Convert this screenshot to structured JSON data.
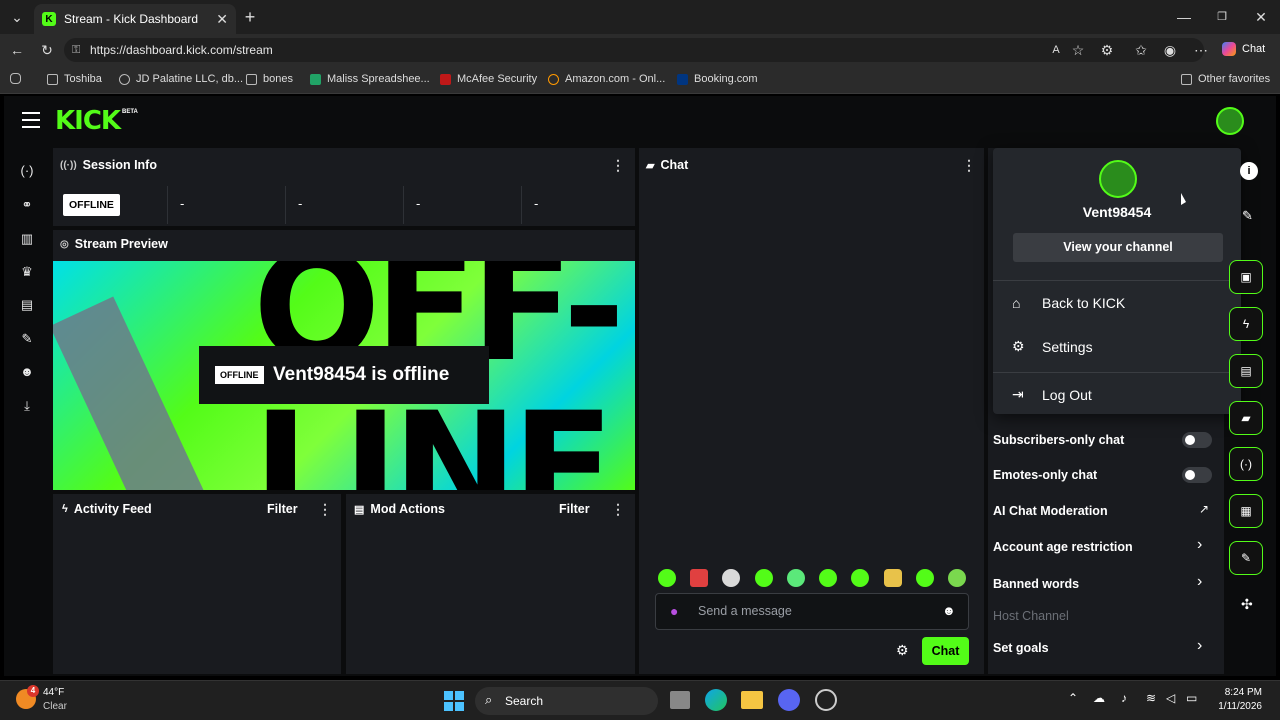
{
  "browser": {
    "tab_title": "Stream - Kick Dashboard",
    "url": "https://dashboard.kick.com/stream",
    "copilot_label": "Chat",
    "favorites": [
      "Toshiba",
      "JD Palatine LLC, db...",
      "bones",
      "Maliss Spreadshee...",
      "McAfee Security",
      "Amazon.com - Onl...",
      "Booking.com"
    ],
    "other_favorites": "Other favorites"
  },
  "app": {
    "logo": "KICK",
    "beta": "BETA"
  },
  "session": {
    "title": "Session Info",
    "status": "OFFLINE",
    "stats": [
      "-",
      "-",
      "-",
      "-"
    ]
  },
  "preview": {
    "title": "Stream Preview",
    "badge": "OFFLINE",
    "offline_text": "Vent98454 is offline",
    "art_text_top": "OFF-",
    "art_text_bottom": "LINE"
  },
  "activity": {
    "title": "Activity Feed",
    "filter": "Filter"
  },
  "mod": {
    "title": "Mod Actions",
    "filter": "Filter"
  },
  "chat": {
    "title": "Chat",
    "placeholder": "Send a message",
    "send_label": "Chat"
  },
  "user_menu": {
    "username": "Vent98454",
    "view_channel": "View your channel",
    "items": [
      "Back to KICK",
      "Settings",
      "Log Out"
    ]
  },
  "chat_settings": {
    "subscribers_only": "Subscribers-only chat",
    "emotes_only": "Emotes-only chat",
    "ai_moderation": "AI Chat Moderation",
    "account_age": "Account age restriction",
    "banned_words": "Banned words",
    "host_channel": "Host Channel",
    "set_goals": "Set goals"
  },
  "taskbar": {
    "temp": "44°F",
    "weather": "Clear",
    "search": "Search",
    "time": "8:24 PM",
    "date": "1/11/2026",
    "weather_badge": "4"
  },
  "colors": {
    "accent": "#53fc18",
    "panel": "#191b1f",
    "bg": "#0b0c0d"
  }
}
